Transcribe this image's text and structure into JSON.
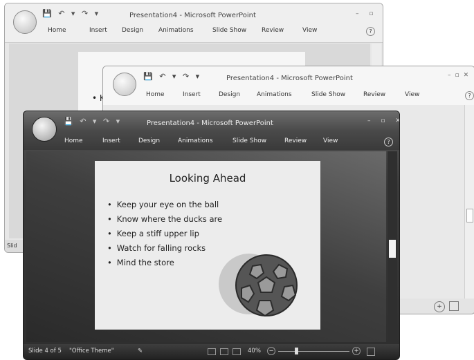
{
  "back_window": {
    "title": "Presentation4 - Microsoft PowerPoint",
    "quick_access": [
      "💾",
      "↶",
      "▾",
      "↷",
      "▾"
    ],
    "tabs": [
      "Home",
      "Insert",
      "Design",
      "Animations",
      "Slide Show",
      "Review",
      "View"
    ],
    "help": "?",
    "status_text": "Slid",
    "slide_fragment": "• K"
  },
  "middle_window": {
    "title": "Presentation4 - Microsoft PowerPoint",
    "quick_access": [
      "💾",
      "↶",
      "▾",
      "↷",
      "▾"
    ],
    "tabs": [
      "Home",
      "Insert",
      "Design",
      "Animations",
      "Slide Show",
      "Review",
      "View"
    ],
    "help": "?"
  },
  "front_window": {
    "title": "Presentation4 - Microsoft PowerPoint",
    "quick_access": [
      "💾",
      "↶",
      "▾",
      "↷",
      "▾"
    ],
    "tabs": [
      "Home",
      "Insert",
      "Design",
      "Animations",
      "Slide Show",
      "Review",
      "View"
    ],
    "help": "?",
    "window_controls": "– ▫ ✕",
    "slide": {
      "title": "Looking Ahead",
      "bullets": [
        "Keep your eye on the ball",
        "Know where the ducks are",
        "Keep a stiff upper lip",
        "Watch for falling rocks",
        "Mind the store"
      ]
    },
    "status": {
      "slide_count": "Slide 4 of 5",
      "theme": "\"Office Theme\"",
      "zoom": "40%",
      "zoom_minus": "−",
      "zoom_plus": "+"
    }
  },
  "colors": {
    "front_dark": "#3b3b3b",
    "middle_light": "#f2f2f2",
    "back_light": "#e7e7e7",
    "slide_bg": "#ececec"
  }
}
